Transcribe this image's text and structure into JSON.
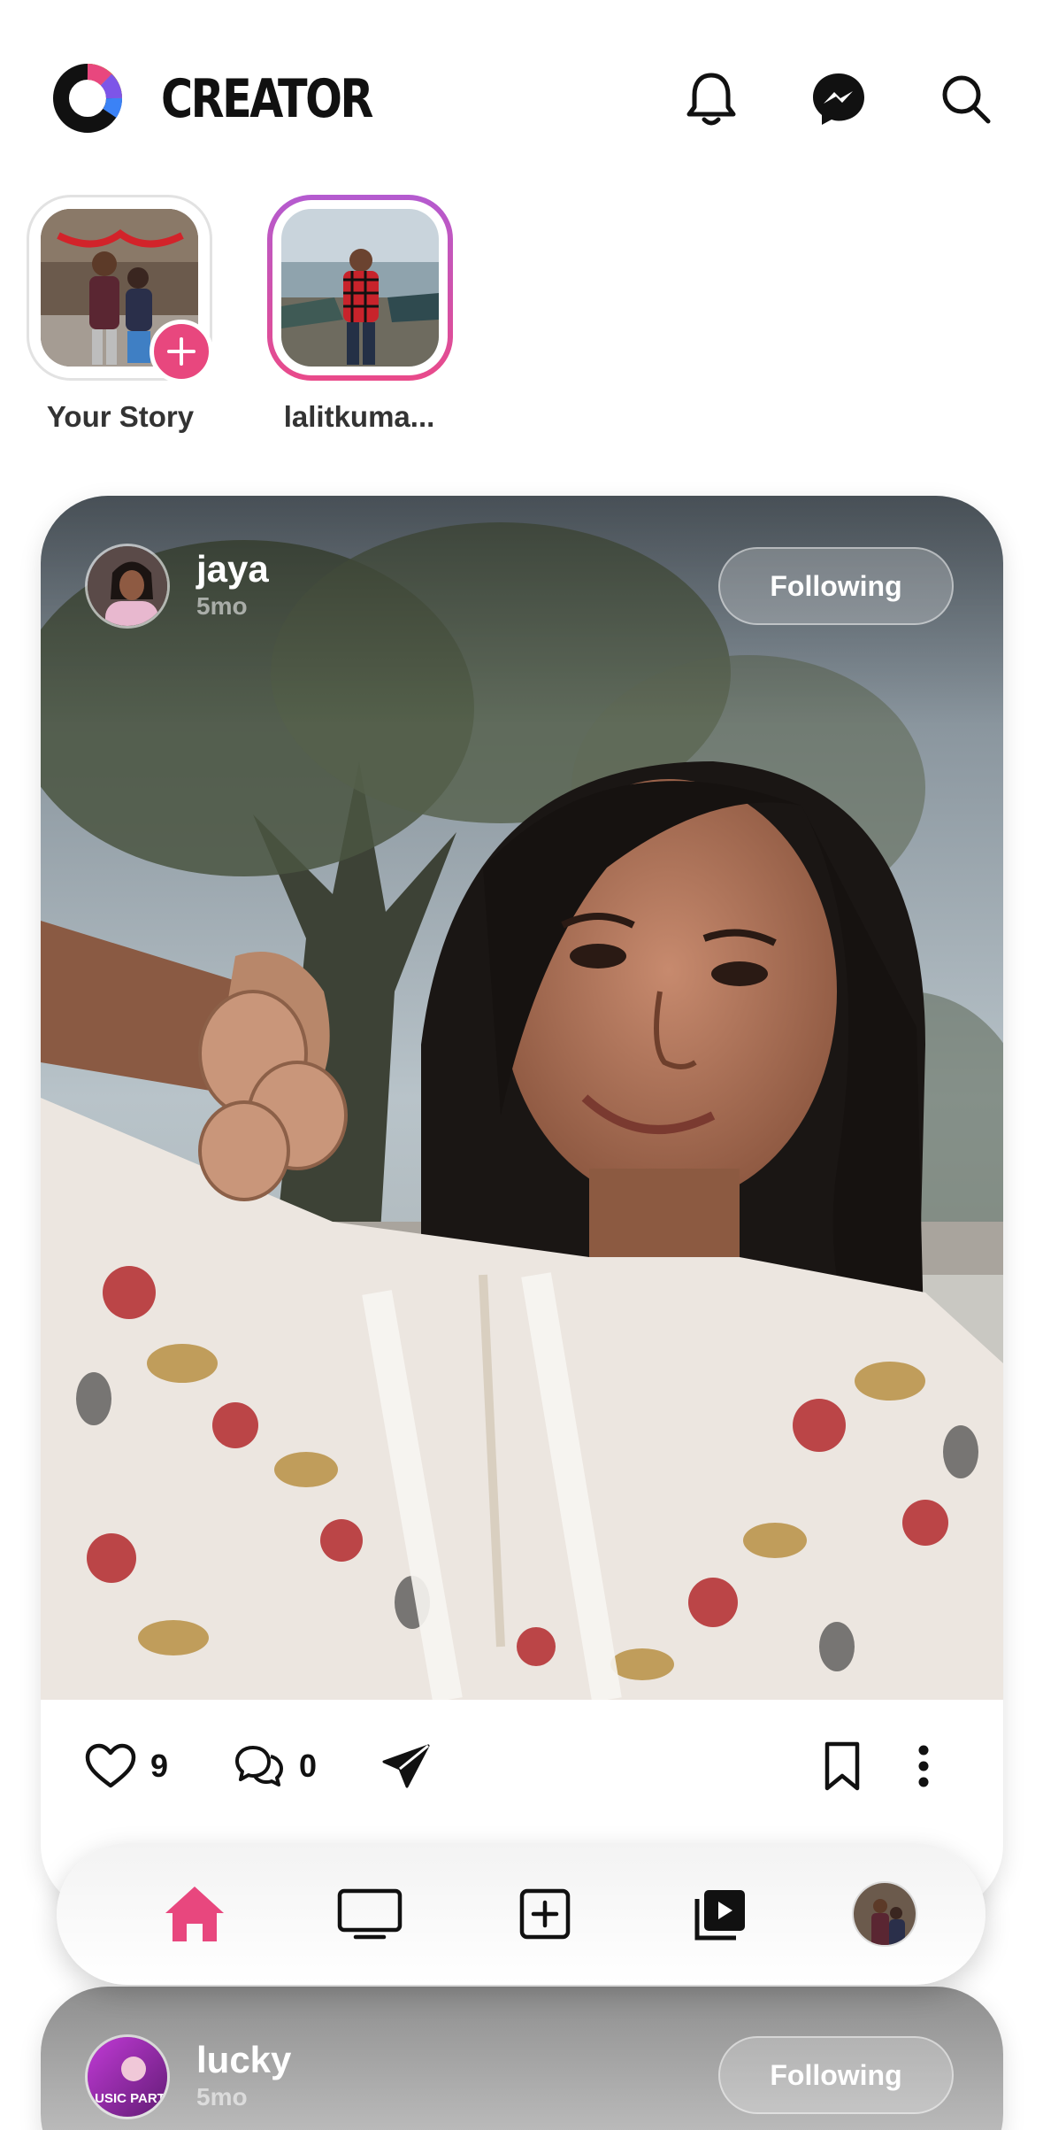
{
  "header": {
    "brand": "CREATOR",
    "icons": [
      "creator-logo-icon",
      "bell-icon",
      "messenger-icon",
      "search-icon"
    ]
  },
  "stories": [
    {
      "label": "Your Story",
      "own": true
    },
    {
      "label": "lalitkuma...",
      "own": false
    }
  ],
  "posts": [
    {
      "username": "jaya",
      "time": "5mo",
      "follow_label": "Following",
      "likes": "9",
      "comments": "0"
    },
    {
      "username": "lucky",
      "time": "5mo",
      "follow_label": "Following",
      "avatar_text": "USIC PART"
    }
  ],
  "bottom_nav": {
    "items": [
      "home-icon",
      "tv-icon",
      "add-post-icon",
      "reels-icon",
      "profile-avatar"
    ],
    "active": "home-icon"
  },
  "colors": {
    "accent": "#e8477e",
    "story_ring_start": "#b45bd0",
    "story_ring_end": "#e94a8a"
  }
}
